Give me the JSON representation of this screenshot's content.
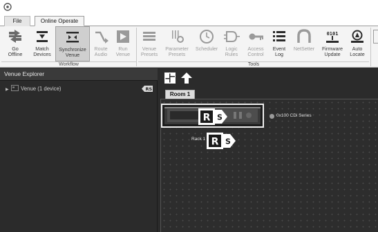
{
  "window": {
    "logo_icon": "app-logo-icon"
  },
  "menu": {
    "tabs": [
      {
        "label": "File"
      },
      {
        "label": "Online Operate"
      }
    ]
  },
  "ribbon": {
    "buttons": [
      {
        "id": "go-offline",
        "line1": "Go",
        "line2": "Offline",
        "icon": "go-offline-icon",
        "enabled": true
      },
      {
        "id": "match-devices",
        "line1": "Match",
        "line2": "Devices",
        "icon": "match-devices-icon",
        "enabled": true
      },
      {
        "id": "synchronize-venue",
        "line1": "Synchronize",
        "line2": "Venue",
        "icon": "synchronize-icon",
        "enabled": true,
        "active": true
      },
      {
        "id": "route-audio",
        "line1": "Route",
        "line2": "Audio",
        "icon": "route-audio-icon",
        "enabled": false
      },
      {
        "id": "run-venue",
        "line1": "Run",
        "line2": "Venue",
        "icon": "run-venue-icon",
        "enabled": false
      },
      {
        "id": "venue-presets",
        "line1": "Venue",
        "line2": "Presets",
        "icon": "venue-presets-icon",
        "enabled": false
      },
      {
        "id": "parameter-presets",
        "line1": "Parameter",
        "line2": "Presets",
        "icon": "parameter-presets-icon",
        "enabled": false
      },
      {
        "id": "scheduler",
        "line1": "Scheduler",
        "line2": "",
        "icon": "clock-icon",
        "enabled": false
      },
      {
        "id": "logic-rules",
        "line1": "Logic",
        "line2": "Rules",
        "icon": "logic-rules-icon",
        "enabled": false
      },
      {
        "id": "access-control",
        "line1": "Access",
        "line2": "Control",
        "icon": "key-icon",
        "enabled": false
      },
      {
        "id": "event-log",
        "line1": "Event",
        "line2": "Log",
        "icon": "event-log-icon",
        "enabled": true
      },
      {
        "id": "netsetter",
        "line1": "NetSetter",
        "line2": "",
        "icon": "netsetter-icon",
        "enabled": false
      },
      {
        "id": "firmware-update",
        "line1": "Firmware",
        "line2": "Update",
        "icon": "firmware-icon",
        "enabled": true
      },
      {
        "id": "auto-locate",
        "line1": "Auto",
        "line2": "Locate",
        "icon": "auto-locate-icon",
        "enabled": true
      }
    ],
    "groups": [
      {
        "label": "Workflow"
      },
      {
        "label": "Tools"
      }
    ]
  },
  "explorer": {
    "title": "Venue Explorer",
    "venue_item": "Venue (1 device)",
    "expand_icon": "chevron-right-icon",
    "venue_icon": "venue-icon",
    "rs_icon": "rs-status-icon"
  },
  "workspace": {
    "toolbar_icons": [
      "layout-icon",
      "up-arrow-icon"
    ],
    "room_tab": "Room 1",
    "device_label": "0x100  CDi Series",
    "rack_label": "Rack 1",
    "rs_badge_r": "R",
    "rs_badge_s": "S"
  }
}
